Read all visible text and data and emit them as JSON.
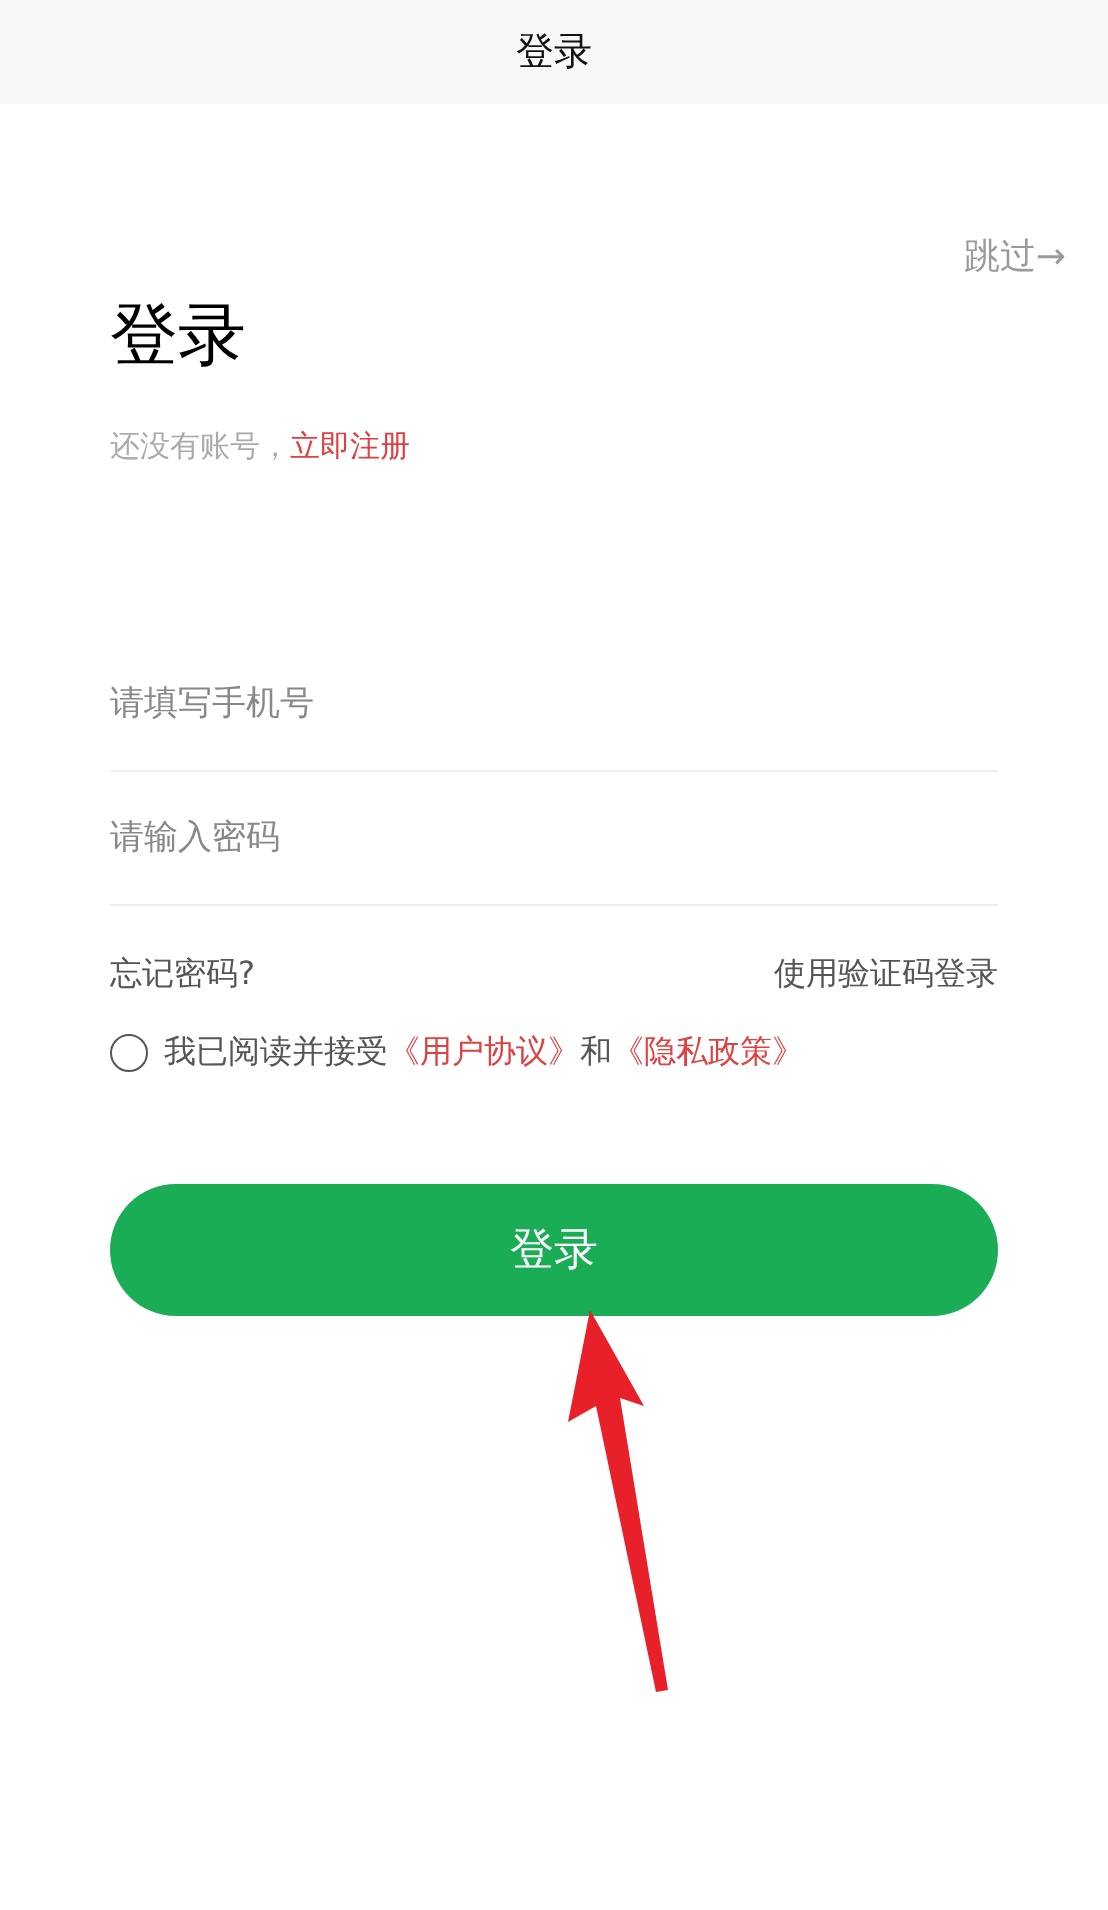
{
  "nav_bar": {
    "title": "登录"
  },
  "skip_link": "跳过→",
  "heading": "登录",
  "register_prompt": {
    "text": "还没有账号，",
    "link": "立即注册"
  },
  "fields": [
    {
      "placeholder": "请填写手机号"
    },
    {
      "placeholder": "请输入密码"
    }
  ],
  "forgot_link": "忘记密码?",
  "sms_login_link": "使用验证码登录",
  "agreement": {
    "checked": false,
    "parts": [
      {
        "kind": "plain",
        "text": "我已阅读并接受"
      },
      {
        "kind": "link",
        "text": "《用户协议》"
      },
      {
        "kind": "plain",
        "text": "和"
      },
      {
        "kind": "link",
        "text": "《隐私政策》"
      }
    ]
  },
  "login_button": "登录"
}
